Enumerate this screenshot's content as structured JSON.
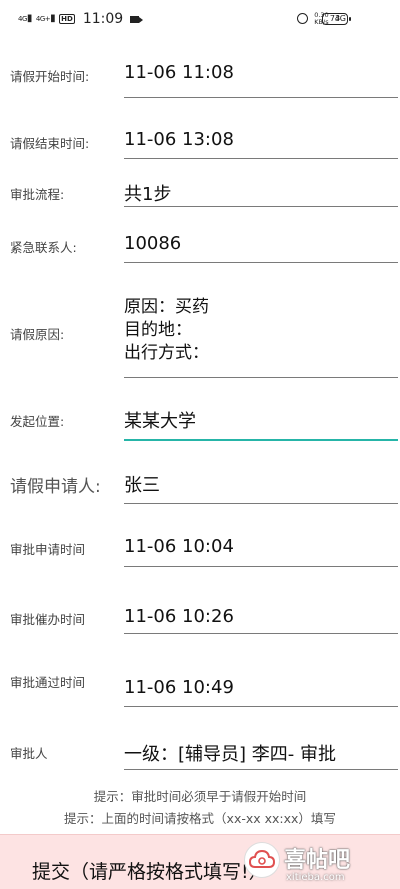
{
  "status_bar": {
    "signal1": "4G",
    "signal2": "4G+",
    "hd": "HD",
    "time": "11:09",
    "speed_top": "0.30",
    "speed_bottom": "KB/s",
    "network": "4G",
    "battery": "73"
  },
  "form": {
    "start_time": {
      "label": "请假开始时间:",
      "value": "11-06 11:08"
    },
    "end_time": {
      "label": "请假结束时间:",
      "value": "11-06 13:08"
    },
    "flow": {
      "label": "审批流程:",
      "value": "共1步"
    },
    "contact": {
      "label": "紧急联系人:",
      "value": "10086"
    },
    "reason": {
      "label": "请假原因:",
      "lines": [
        "原因：买药",
        "目的地：",
        "出行方式："
      ]
    },
    "location": {
      "label": "发起位置:",
      "value": "某某大学"
    },
    "applicant": {
      "label": "请假申请人:",
      "value": "张三"
    },
    "apply_time": {
      "label": "审批申请时间",
      "value": "11-06 10:04"
    },
    "urge_time": {
      "label": "审批催办时间",
      "value": "11-06 10:26"
    },
    "pass_time": {
      "label": "审批通过时间",
      "value": "11-06 10:49"
    },
    "approver": {
      "label": "审批人",
      "value": "一级：[辅导员] 李四- 审批"
    }
  },
  "hints": [
    "提示：审批时间必须早于请假开始时间",
    "提示：上面的时间请按格式（xx-xx xx:xx）填写"
  ],
  "submit_label": "提交（请严格按格式填写!）",
  "watermark": {
    "text": "喜帖吧",
    "sub": "xitieba.com"
  }
}
